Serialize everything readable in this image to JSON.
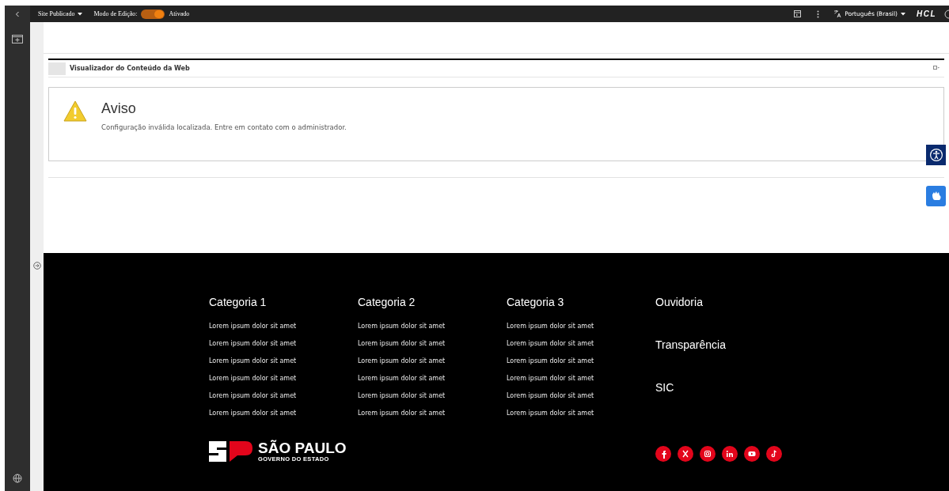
{
  "toolbar": {
    "site_menu": "Site Publicado",
    "edit_mode": {
      "label": "Modo de Edição:",
      "on": true,
      "state_label": "Ativado"
    },
    "language": "Português (Brasil)",
    "brand": "HCL"
  },
  "portlet": {
    "title": "Visualizador do Conteúdo da Web"
  },
  "warning": {
    "title": "Aviso",
    "message": "Configuração inválida localizada. Entre em contato com o administrador."
  },
  "footer": {
    "columns": [
      {
        "heading": "Categoria 1",
        "links": [
          "Lorem ipsum dolor sit amet",
          "Lorem ipsum dolor sit amet",
          "Lorem ipsum dolor sit amet",
          "Lorem ipsum dolor sit amet",
          "Lorem ipsum dolor sit amet",
          "Lorem ipsum dolor sit amet"
        ]
      },
      {
        "heading": "Categoria 2",
        "links": [
          "Lorem ipsum dolor sit amet",
          "Lorem ipsum dolor sit amet",
          "Lorem ipsum dolor sit amet",
          "Lorem ipsum dolor sit amet",
          "Lorem ipsum dolor sit amet",
          "Lorem ipsum dolor sit amet"
        ]
      },
      {
        "heading": "Categoria 3",
        "links": [
          "Lorem ipsum dolor sit amet",
          "Lorem ipsum dolor sit amet",
          "Lorem ipsum dolor sit amet",
          "Lorem ipsum dolor sit amet",
          "Lorem ipsum dolor sit amet",
          "Lorem ipsum dolor sit amet"
        ]
      }
    ],
    "side_links": [
      "Ouvidoria",
      "Transparência",
      "SIC"
    ],
    "logo": {
      "title": "SÃO PAULO",
      "subtitle": "GOVERNO DO ESTADO"
    },
    "socials": [
      {
        "kind": "facebook"
      },
      {
        "kind": "x"
      },
      {
        "kind": "instagram"
      },
      {
        "kind": "linkedin"
      },
      {
        "kind": "youtube"
      },
      {
        "kind": "tiktok"
      }
    ]
  }
}
